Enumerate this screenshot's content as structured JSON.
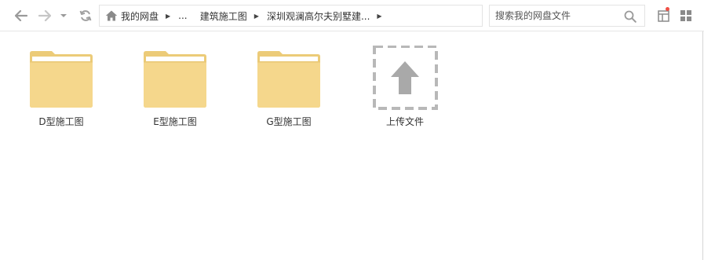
{
  "toolbar": {
    "back_icon": "arrow-left-icon",
    "forward_icon": "arrow-right-icon",
    "dropdown_icon": "caret-down-icon",
    "refresh_icon": "refresh-icon"
  },
  "breadcrumb": {
    "items": [
      {
        "label": "我的网盘",
        "icon": "home-icon"
      },
      {
        "label": "..."
      },
      {
        "label": "建筑施工图"
      },
      {
        "label": "深圳观澜高尔夫别墅建..."
      }
    ]
  },
  "search": {
    "placeholder": "搜索我的网盘文件",
    "value": ""
  },
  "files": [
    {
      "label": "D型施工图",
      "type": "folder"
    },
    {
      "label": "E型施工图",
      "type": "folder"
    },
    {
      "label": "G型施工图",
      "type": "folder"
    }
  ],
  "upload": {
    "label": "上传文件",
    "icon": "upload-arrow-icon"
  },
  "colors": {
    "folder_body": "#f5d78c",
    "folder_edge": "#e8c574",
    "folder_paper": "#ffffff",
    "icon_gray": "#a9a9a9",
    "upload_border": "#b8b8b8",
    "notify_dot": "#f04f45"
  }
}
